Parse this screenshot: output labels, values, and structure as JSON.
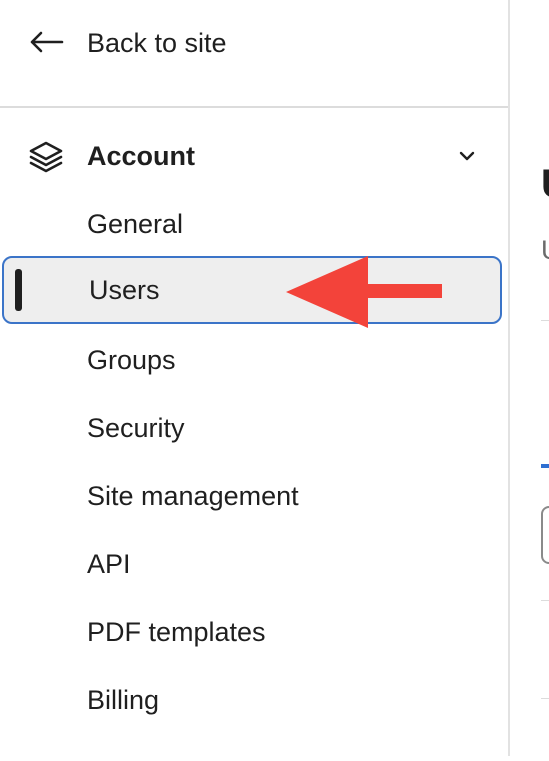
{
  "back_link": {
    "label": "Back to site",
    "icon": "arrow-left-icon"
  },
  "section": {
    "title": "Account",
    "icon": "layers-icon",
    "toggle_icon": "chevron-down-icon",
    "items": [
      {
        "label": "General",
        "active": false
      },
      {
        "label": "Users",
        "active": true
      },
      {
        "label": "Groups",
        "active": false
      },
      {
        "label": "Security",
        "active": false
      },
      {
        "label": "Site management",
        "active": false
      },
      {
        "label": "API",
        "active": false
      },
      {
        "label": "PDF templates",
        "active": false
      },
      {
        "label": "Billing",
        "active": false
      }
    ]
  },
  "main": {
    "heading_fragment": "U",
    "subtitle_fragment": "U"
  },
  "colors": {
    "active_border": "#3b74c8",
    "active_background": "#eeeeee",
    "annotation_arrow": "#f3433a",
    "tab_accent": "#2f6fd1"
  }
}
